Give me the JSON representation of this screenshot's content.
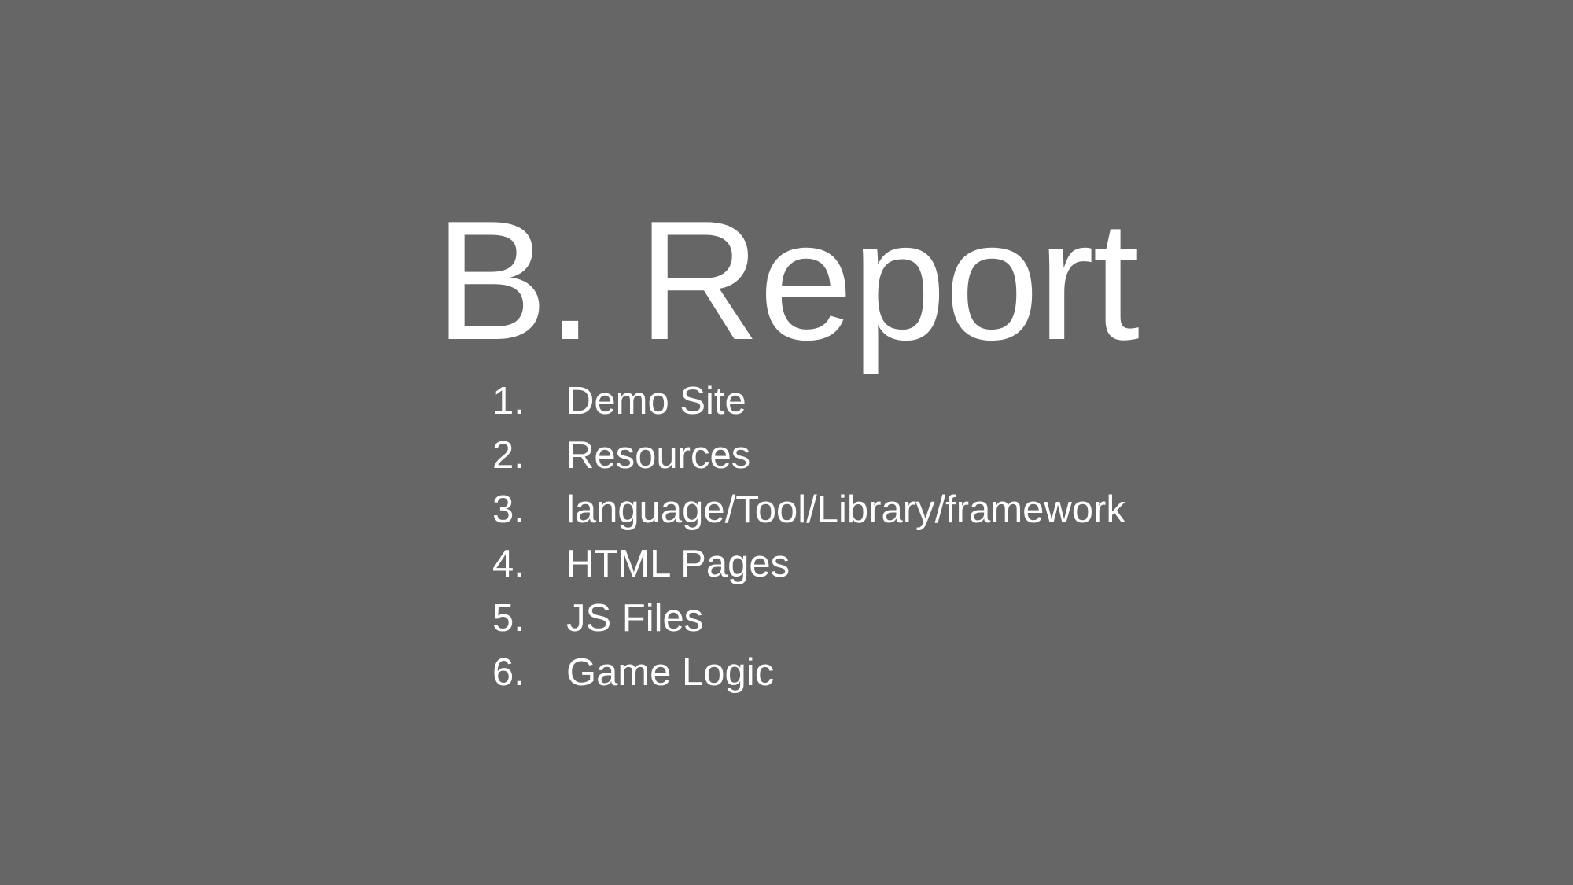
{
  "slide": {
    "background_color": "#666666",
    "text_color": "#ffffff",
    "title": "B. Report",
    "items": [
      {
        "number": "1.",
        "label": "Demo Site"
      },
      {
        "number": "2.",
        "label": "Resources"
      },
      {
        "number": "3.",
        "label": "language/Tool/Library/framework"
      },
      {
        "number": "4.",
        "label": "HTML Pages"
      },
      {
        "number": "5.",
        "label": "JS Files"
      },
      {
        "number": "6.",
        "label": "Game Logic"
      }
    ]
  }
}
